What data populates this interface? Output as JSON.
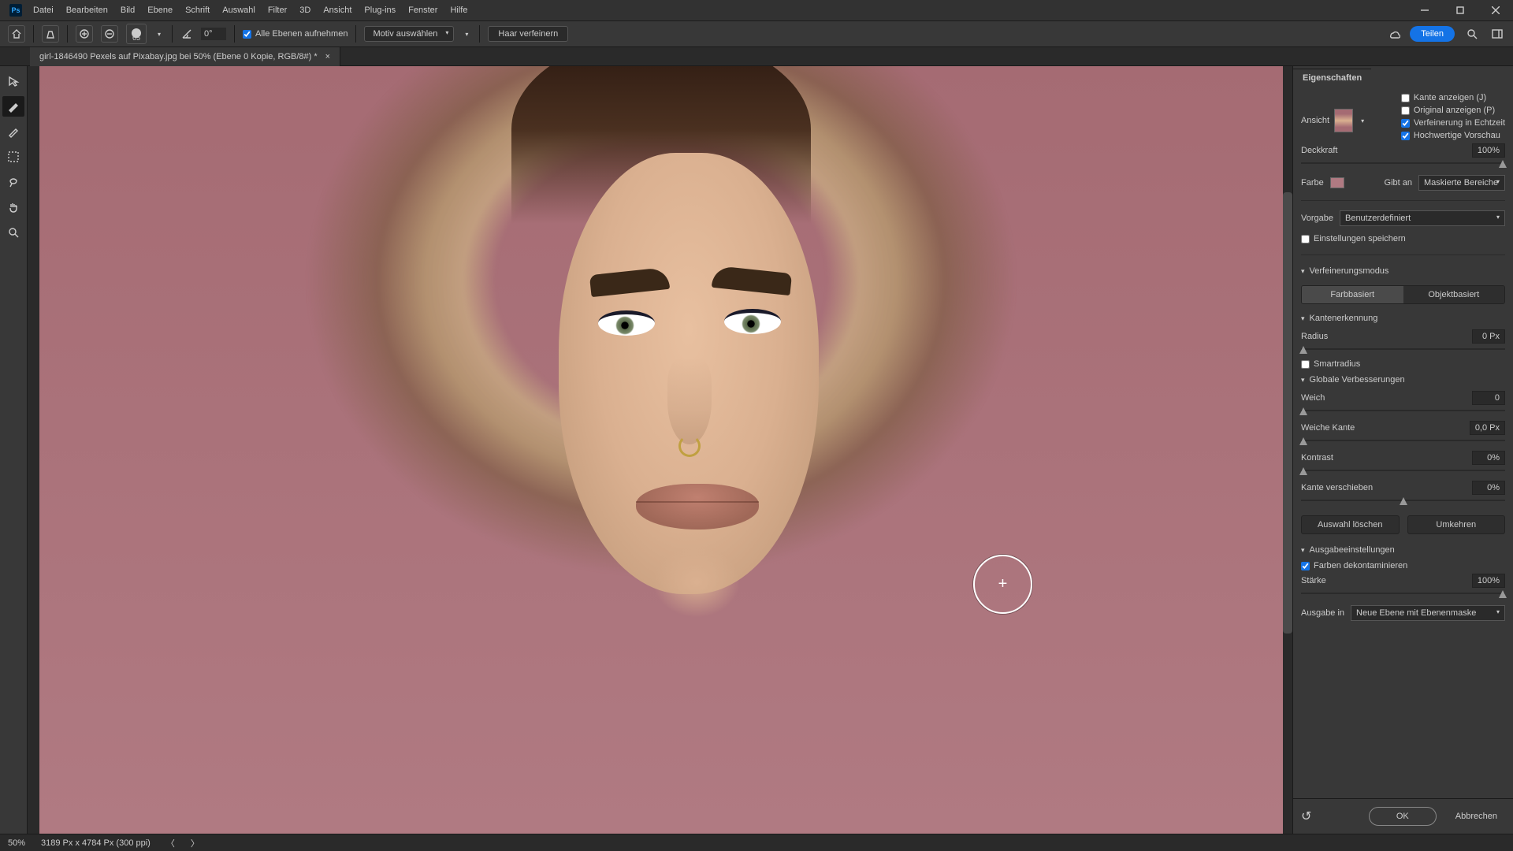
{
  "menu": {
    "items": [
      "Datei",
      "Bearbeiten",
      "Bild",
      "Ebene",
      "Schrift",
      "Auswahl",
      "Filter",
      "3D",
      "Ansicht",
      "Plug-ins",
      "Fenster",
      "Hilfe"
    ]
  },
  "options": {
    "brush_size": "65",
    "angle": "0°",
    "sample_all": "Alle Ebenen aufnehmen",
    "select_subject": "Motiv auswählen",
    "refine_hair": "Haar verfeinern",
    "share": "Teilen"
  },
  "doc": {
    "tab": "girl-1846490 Pexels auf Pixabay.jpg bei 50% (Ebene 0 Kopie, RGB/8#) *"
  },
  "panel": {
    "title": "Eigenschaften",
    "view_label": "Ansicht",
    "show_edge": "Kante anzeigen (J)",
    "show_original": "Original anzeigen (P)",
    "realtime_refine": "Verfeinerung in Echtzeit",
    "hq_preview": "Hochwertige Vorschau",
    "opacity_label": "Deckkraft",
    "opacity_val": "100%",
    "color_label": "Farbe",
    "indicates": "Gibt an",
    "indicates_val": "Maskierte Bereiche",
    "preset_label": "Vorgabe",
    "preset_val": "Benutzerdefiniert",
    "remember": "Einstellungen speichern",
    "refine_mode": "Verfeinerungsmodus",
    "color_aware": "Farbbasiert",
    "object_aware": "Objektbasiert",
    "edge_detect": "Kantenerkennung",
    "radius": "Radius",
    "radius_val": "0 Px",
    "smart_radius": "Smartradius",
    "global_refine": "Globale Verbesserungen",
    "smooth": "Weich",
    "smooth_val": "0",
    "feather": "Weiche Kante",
    "feather_val": "0,0 Px",
    "contrast": "Kontrast",
    "contrast_val": "0%",
    "shift_edge": "Kante verschieben",
    "shift_edge_val": "0%",
    "clear_sel": "Auswahl löschen",
    "invert": "Umkehren",
    "output_settings": "Ausgabeeinstellungen",
    "decontaminate": "Farben dekontaminieren",
    "amount": "Stärke",
    "amount_val": "100%",
    "output_to": "Ausgabe in",
    "output_to_val": "Neue Ebene mit Ebenenmaske",
    "ok": "OK",
    "cancel": "Abbrechen"
  },
  "status": {
    "zoom": "50%",
    "doc_info": "3189 Px x 4784 Px (300 ppi)"
  }
}
